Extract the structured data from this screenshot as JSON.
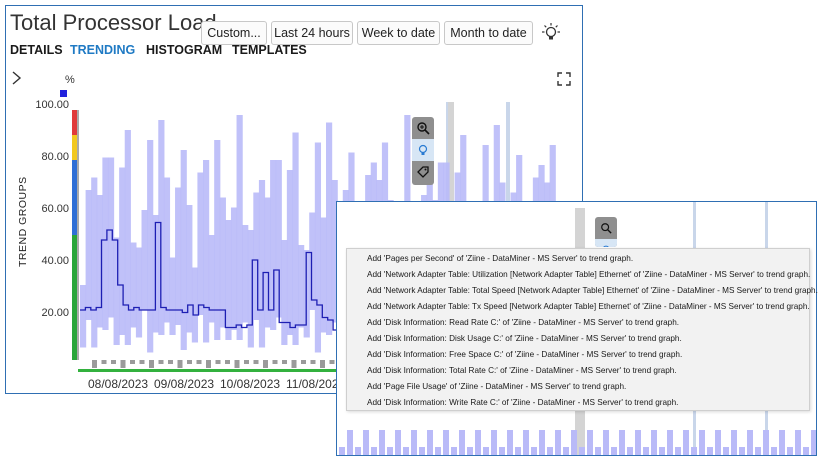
{
  "main": {
    "title": "Total Processor Load",
    "buttons": [
      "Custom...",
      "Last 24 hours",
      "Week to date",
      "Month to date"
    ],
    "tabs": [
      "DETAILS",
      "TRENDING",
      "HISTOGRAM",
      "TEMPLATES"
    ],
    "active_tab": "TRENDING",
    "side_panel_label": "TREND GROUPS",
    "icons": [
      "lightbulb-icon",
      "expand-icon",
      "chevron-right-icon",
      "zoom-icon",
      "tag-icon"
    ]
  },
  "chart_data": {
    "type": "line",
    "y_unit": "%",
    "ylim": [
      0,
      100
    ],
    "y_ticks": [
      "100.00",
      "80.00",
      "60.00",
      "40.00",
      "20.00"
    ],
    "x_ticks": [
      "08/08/2023",
      "09/08/2023",
      "10/08/2023",
      "11/08/2023"
    ],
    "series": [
      {
        "values": [
          20,
          21,
          20,
          21,
          48,
          52,
          48,
          30,
          22,
          20,
          21,
          20,
          20,
          20,
          55,
          21,
          20,
          20,
          20,
          19,
          22,
          18,
          22,
          21,
          20,
          20,
          20,
          13,
          13,
          14,
          13,
          14,
          40,
          20,
          35,
          20,
          36,
          15,
          15,
          13,
          14,
          14,
          43,
          24,
          22,
          17,
          16,
          12,
          14,
          19,
          15,
          15
        ]
      }
    ],
    "range_band": [
      [
        5,
        30
      ],
      [
        15,
        55
      ],
      [
        3,
        70
      ],
      [
        10,
        50
      ],
      [
        8,
        75
      ],
      [
        12,
        62
      ],
      [
        6,
        40
      ],
      [
        9,
        55
      ],
      [
        4,
        80
      ],
      [
        10,
        45
      ]
    ],
    "threshold_bands": [
      {
        "color": "#e03a3a",
        "from": 100,
        "to": 90
      },
      {
        "color": "#f2c81e",
        "from": 90,
        "to": 80
      },
      {
        "color": "#2f6fd6",
        "from": 80,
        "to": 50
      },
      {
        "color": "#29a53a",
        "from": 50,
        "to": 0
      }
    ],
    "colors": {
      "range": "#b9baf8",
      "line": "#1d1fb3",
      "grid_highlight": "#c9d6ea",
      "marker": "#2222dd"
    }
  },
  "context_menu": {
    "items": [
      "Add 'Pages per Second' of 'Ziine - DataMiner - MS Server' to trend graph.",
      "Add 'Network Adapter Table: Utilization [Network Adapter Table] Ethernet' of 'Ziine - DataMiner - MS Server' to trend graph.",
      "Add 'Network Adapter Table: Total Speed [Network Adapter Table] Ethernet' of 'Ziine - DataMiner - MS Server' to trend graph.",
      "Add 'Network Adapter Table: Tx Speed [Network Adapter Table] Ethernet' of 'Ziine - DataMiner - MS Server' to trend graph.",
      "Add 'Disk Information: Read Rate C:' of 'Ziine - DataMiner - MS Server' to trend graph.",
      "Add 'Disk Information: Disk Usage C:' of 'Ziine - DataMiner - MS Server' to trend graph.",
      "Add 'Disk Information: Free Space C:' of 'Ziine - DataMiner - MS Server' to trend graph.",
      "Add 'Disk Information: Total Rate C:' of 'Ziine - DataMiner - MS Server' to trend graph.",
      "Add 'Page File Usage' of 'Ziine - DataMiner - MS Server' to trend graph.",
      "Add 'Disk Information: Write Rate C:' of 'Ziine - DataMiner - MS Server' to trend graph."
    ]
  }
}
